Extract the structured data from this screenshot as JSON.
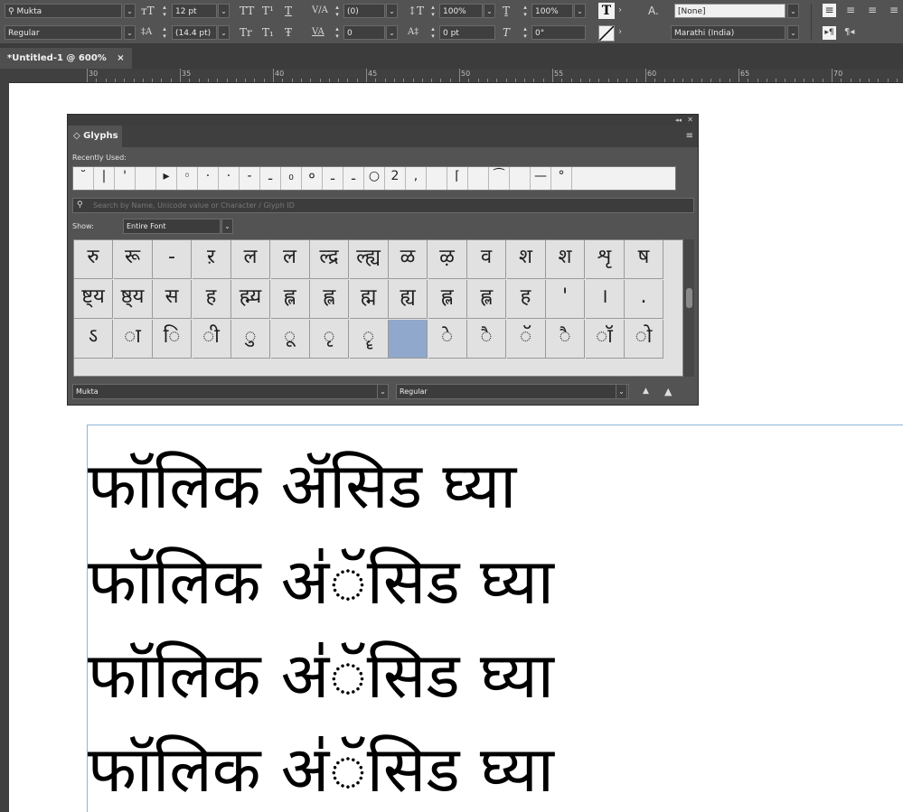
{
  "control_panel": {
    "font_family": "Mukta",
    "font_style": "Regular",
    "font_size": "12 pt",
    "leading": "(14.4 pt)",
    "kerning": "(0)",
    "tracking": "0",
    "vertical_scale": "100%",
    "horizontal_scale": "100%",
    "baseline_shift": "0 pt",
    "skew": "0°",
    "character_style": "[None]",
    "language": "Marathi (India)",
    "label_tt": "TT",
    "label_t_super": "T¹",
    "label_t_under": "T",
    "label_tr_smallcaps": "Tr",
    "label_t_sub": "T₁",
    "label_t_strike": "Ŧ",
    "label_a": "A."
  },
  "document": {
    "tab_title": "*Untitled-1 @ 600%",
    "close_glyph": "×"
  },
  "ruler": {
    "labels": [
      "30",
      "35",
      "40",
      "45",
      "50",
      "55",
      "60",
      "65",
      "70"
    ]
  },
  "glyphs_panel": {
    "title": "◇ Glyphs",
    "recently_used_label": "Recently Used:",
    "recent_glyphs": [
      "˘",
      "|",
      "'",
      "",
      "▸",
      "◦",
      "·",
      "·",
      "-",
      "ـ",
      "₀",
      "०",
      "ـ",
      "ـ",
      "○",
      "2",
      ",",
      "",
      "⌈",
      "",
      "͡",
      "",
      "—",
      "°"
    ],
    "search_placeholder": "Search by Name, Unicode value or Character / Glyph ID",
    "show_label": "Show:",
    "show_value": "Entire Font",
    "rows": [
      [
        "रु",
        "रू",
        "-",
        "ऱ",
        "ल",
        "ल",
        "ल्द्र",
        "ल्ह्य",
        "ळ",
        "ऴ",
        "व",
        "श",
        "श",
        "शृ",
        "ष"
      ],
      [
        "ष्ट्य",
        "ष्ठ्य",
        "स",
        "ह",
        "ह्म्य",
        "ह्ल",
        "ह्ल",
        "ह्म",
        "ह्य",
        "ह्ल",
        "ह्ल",
        "ह",
        "'",
        "।",
        "."
      ],
      [
        "ऽ",
        "ा",
        "ि",
        "ी",
        "ु",
        "ू",
        "ृ",
        "ॄ",
        "",
        "े",
        "ै",
        "ॅ",
        "ै",
        "ॉ",
        "ो"
      ]
    ],
    "font_value": "Mukta",
    "style_value": "Regular",
    "collapse_glyph": "◂◂",
    "close_glyph": "✕",
    "menu_glyph": "≡"
  },
  "text_frame": {
    "lines": [
      "फॉलिक ॲसिड घ्या",
      "फॉलिक अ॑ॅसिड घ्या",
      "फॉलिक अ॑ॅसिड घ्या",
      "फॉलिक अ॑ॅसिड घ्या"
    ]
  }
}
